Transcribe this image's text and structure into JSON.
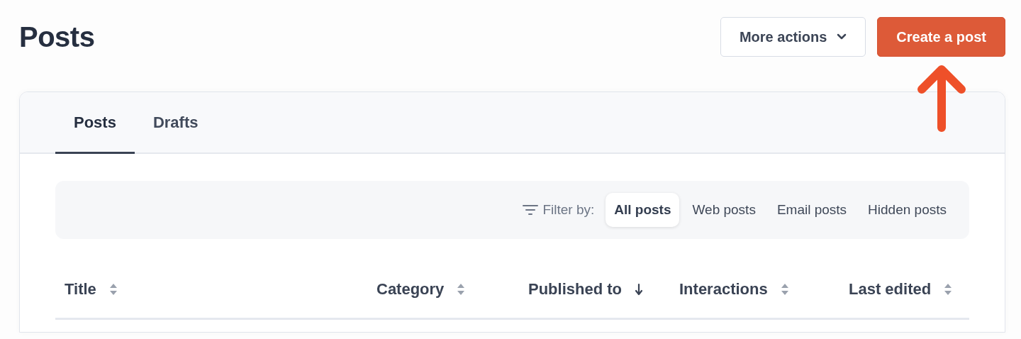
{
  "page_title": "Posts",
  "actions": [
    {
      "label": "More actions",
      "kind": "dropdown"
    },
    {
      "label": "Create a post",
      "kind": "primary"
    }
  ],
  "tabs": [
    {
      "label": "Posts",
      "selected": true
    },
    {
      "label": "Drafts",
      "selected": false
    }
  ],
  "filter": {
    "label": "Filter by:",
    "options": [
      {
        "label": "All posts",
        "selected": true
      },
      {
        "label": "Web posts",
        "selected": false
      },
      {
        "label": "Email posts",
        "selected": false
      },
      {
        "label": "Hidden posts",
        "selected": false
      }
    ]
  },
  "table": {
    "columns": [
      {
        "label": "Title",
        "sorted": false
      },
      {
        "label": "Category",
        "sorted": false
      },
      {
        "label": "Published to",
        "sorted": true
      },
      {
        "label": "Interactions",
        "sorted": false
      },
      {
        "label": "Last edited",
        "sorted": false
      }
    ]
  }
}
